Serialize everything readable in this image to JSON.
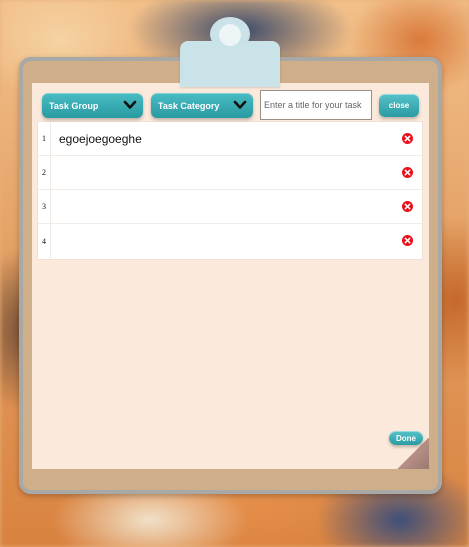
{
  "toolbar": {
    "task_group_label": "Task Group",
    "task_category_label": "Task Category",
    "title_placeholder": "Enter a title for your task",
    "title_value": "",
    "close_label": "close"
  },
  "tasks": [
    {
      "num": "1",
      "text": "egoejoegoeghe"
    },
    {
      "num": "2",
      "text": ""
    },
    {
      "num": "3",
      "text": ""
    },
    {
      "num": "4",
      "text": ""
    }
  ],
  "footer": {
    "done_label": "Done"
  },
  "colors": {
    "accent": "#2fa3aa",
    "delete": "#e8101b",
    "paper": "#fbeadc",
    "board": "#cfae8a"
  },
  "icons": {
    "dropdown": "chevron-down-icon",
    "delete": "close-circle-icon"
  }
}
